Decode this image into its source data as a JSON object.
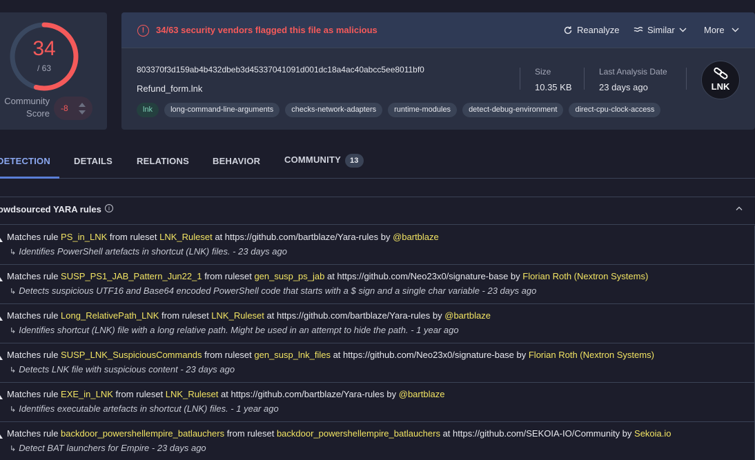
{
  "score": {
    "detections": "34",
    "total": "/ 63",
    "detection_ratio": 0.54,
    "community_label_1": "Community",
    "community_label_2": "Score",
    "community_score": "-8"
  },
  "alert": {
    "text": "34/63 security vendors flagged this file as malicious",
    "color": "#f55a5a"
  },
  "actions": {
    "reanalyze": "Reanalyze",
    "similar": "Similar",
    "more": "More"
  },
  "file": {
    "hash": "803370f3d159ab4b432dbeb3d45337041091d001dc18a4ac40abcc5ee8011bf0",
    "name": "Refund_form.lnk",
    "tags": [
      "lnk",
      "long-command-line-arguments",
      "checks-network-adapters",
      "runtime-modules",
      "detect-debug-environment",
      "direct-cpu-clock-access"
    ],
    "size_label": "Size",
    "size": "10.35 KB",
    "date_label": "Last Analysis Date",
    "date": "23 days ago",
    "type": "LNK"
  },
  "tabs": [
    {
      "label": "DETECTION"
    },
    {
      "label": "DETAILS"
    },
    {
      "label": "RELATIONS"
    },
    {
      "label": "BEHAVIOR"
    },
    {
      "label": "COMMUNITY",
      "badge": "13"
    }
  ],
  "section": {
    "title": "rowdsourced YARA rules",
    "info": "i"
  },
  "rules": [
    {
      "prefix": "Matches rule ",
      "rule": "PS_in_LNK",
      "mid1": " from ruleset ",
      "ruleset": "LNK_Ruleset",
      "mid2": " at https://github.com/bartblaze/Yara-rules by ",
      "author": "@bartblaze",
      "desc": "Identifies PowerShell artefacts in shortcut (LNK) files. - 23 days ago"
    },
    {
      "prefix": "Matches rule ",
      "rule": "SUSP_PS1_JAB_Pattern_Jun22_1",
      "mid1": " from ruleset ",
      "ruleset": "gen_susp_ps_jab",
      "mid2": " at https://github.com/Neo23x0/signature-base by ",
      "author": "Florian Roth (Nextron Systems)",
      "desc": "Detects suspicious UTF16 and Base64 encoded PowerShell code that starts with a $ sign and a single char variable - 23 days ago"
    },
    {
      "prefix": "Matches rule ",
      "rule": "Long_RelativePath_LNK",
      "mid1": " from ruleset ",
      "ruleset": "LNK_Ruleset",
      "mid2": " at https://github.com/bartblaze/Yara-rules by ",
      "author": "@bartblaze",
      "desc": "Identifies shortcut (LNK) file with a long relative path. Might be used in an attempt to hide the path. - 1 year ago"
    },
    {
      "prefix": "Matches rule ",
      "rule": "SUSP_LNK_SuspiciousCommands",
      "mid1": " from ruleset ",
      "ruleset": "gen_susp_lnk_files",
      "mid2": " at https://github.com/Neo23x0/signature-base by ",
      "author": "Florian Roth (Nextron Systems)",
      "desc": "Detects LNK file with suspicious content - 23 days ago"
    },
    {
      "prefix": "Matches rule ",
      "rule": "EXE_in_LNK",
      "mid1": " from ruleset ",
      "ruleset": "LNK_Ruleset",
      "mid2": " at https://github.com/bartblaze/Yara-rules by ",
      "author": "@bartblaze",
      "desc": "Identifies executable artefacts in shortcut (LNK) files. - 1 year ago"
    },
    {
      "prefix": "Matches rule ",
      "rule": "backdoor_powershellempire_batlauchers",
      "mid1": " from ruleset ",
      "ruleset": "backdoor_powershellempire_batlauchers",
      "mid2": " at https://github.com/SEKOIA-IO/Community by ",
      "author": "Sekoia.io",
      "desc": "Detect BAT launchers for Empire - 23 days ago"
    }
  ]
}
